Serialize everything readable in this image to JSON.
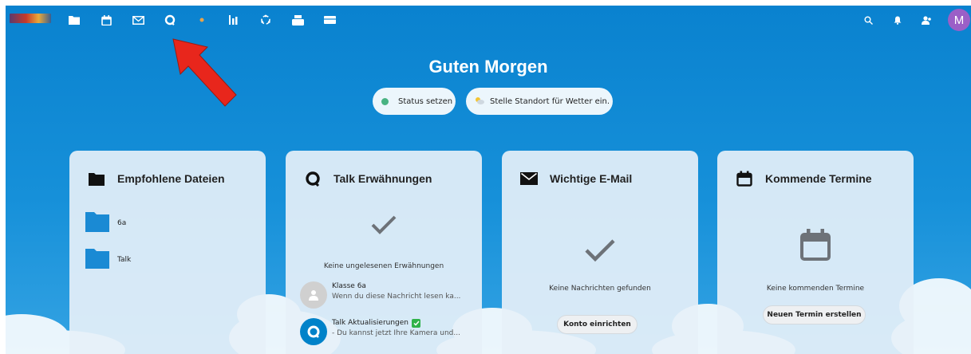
{
  "greeting": "Guten Morgen",
  "status": {
    "label": "Status setzen",
    "dot_color": "#49b382"
  },
  "weather": {
    "label": "Stelle Standort für Wetter ein."
  },
  "header": {
    "nav_icons": [
      "folder-icon",
      "calendar-icon",
      "mail-icon",
      "talk-icon",
      "circle-icon",
      "activity-icon",
      "recycle-icon",
      "print-icon",
      "card-icon"
    ],
    "right_icons": [
      "search-icon",
      "bell-icon",
      "contacts-icon"
    ],
    "avatar_letter": "M",
    "avatar_color": "#9b5fc7"
  },
  "panels": {
    "files": {
      "title": "Empfohlene Dateien",
      "items": [
        {
          "name": "6a"
        },
        {
          "name": "Talk"
        }
      ]
    },
    "talk": {
      "title": "Talk Erwähnungen",
      "empty_text": "Keine ungelesenen Erwähnungen",
      "items": [
        {
          "title": "Klasse 6a",
          "subtitle": "Wenn du diese Nachricht lesen ka..."
        },
        {
          "title": "Talk Aktualisierungen",
          "subtitle": "- Du kannst jetzt Ihre Kamera und..."
        }
      ]
    },
    "mail": {
      "title": "Wichtige E-Mail",
      "empty_text": "Keine Nachrichten gefunden",
      "button": "Konto einrichten"
    },
    "calendar": {
      "title": "Kommende Termine",
      "empty_text": "Keine kommenden Termine",
      "button": "Neuen Termin erstellen"
    }
  },
  "colors": {
    "background": "#0a82cf",
    "accent_arrow": "#e8261c",
    "folder": "#1a8ad4"
  }
}
